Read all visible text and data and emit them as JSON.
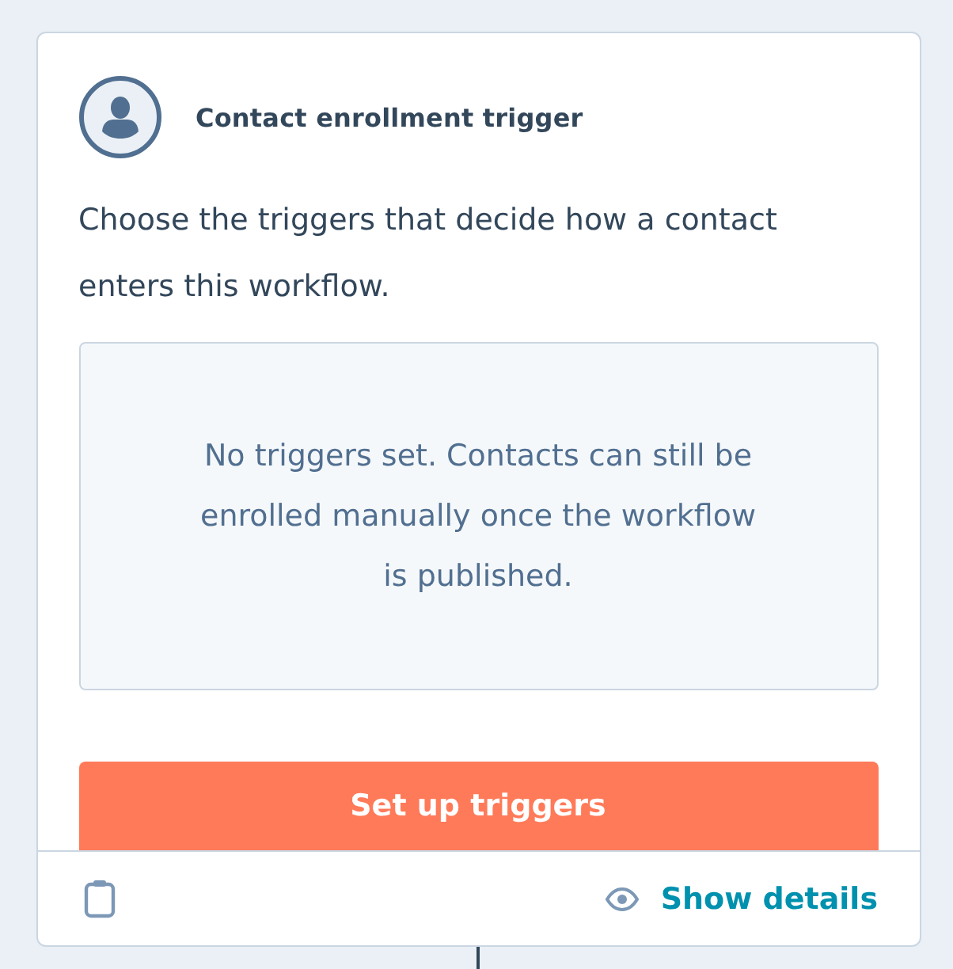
{
  "card": {
    "title": "Contact enrollment trigger",
    "description": "Choose the triggers that decide how a contact enters this workflow.",
    "empty_state": "No triggers set. Contacts can still be enrolled manually once the workflow is published.",
    "primary_button": "Set up triggers"
  },
  "footer": {
    "details_link": "Show details"
  }
}
